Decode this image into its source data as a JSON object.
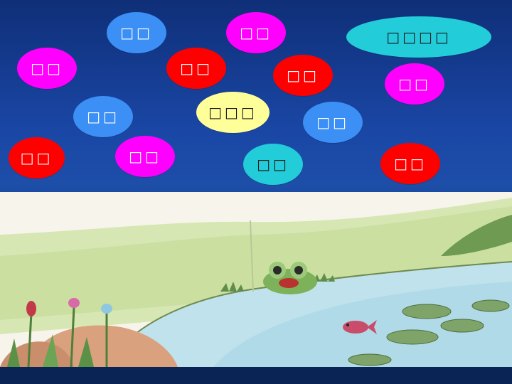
{
  "slide": {
    "bubbles": [
      {
        "id": "b1",
        "label": "□□",
        "color": "#3b8ff5"
      },
      {
        "id": "b2",
        "label": "□□",
        "color": "#ff00ff"
      },
      {
        "id": "b3",
        "label": "□□□□",
        "color": "#22ccd8"
      },
      {
        "id": "b4",
        "label": "□□",
        "color": "#ff00ff"
      },
      {
        "id": "b5",
        "label": "□□",
        "color": "#ff0000"
      },
      {
        "id": "b6",
        "label": "□□",
        "color": "#ff0000"
      },
      {
        "id": "b7",
        "label": "□□",
        "color": "#ff00ff"
      },
      {
        "id": "b8",
        "label": "□□",
        "color": "#3b8ff5"
      },
      {
        "id": "b9",
        "label": "□□□",
        "color": "#ffff99"
      },
      {
        "id": "b10",
        "label": "□□",
        "color": "#3b8ff5"
      },
      {
        "id": "b11",
        "label": "□□",
        "color": "#ff0000"
      },
      {
        "id": "b12",
        "label": "□□",
        "color": "#ff00ff"
      },
      {
        "id": "b13",
        "label": "□□",
        "color": "#22ccd8"
      },
      {
        "id": "b14",
        "label": "□□",
        "color": "#ff0000"
      }
    ]
  },
  "illustration": {
    "scene": [
      "pond-water",
      "grass-bank",
      "frog",
      "fish",
      "lily-pads",
      "flowers",
      "rocks"
    ]
  }
}
